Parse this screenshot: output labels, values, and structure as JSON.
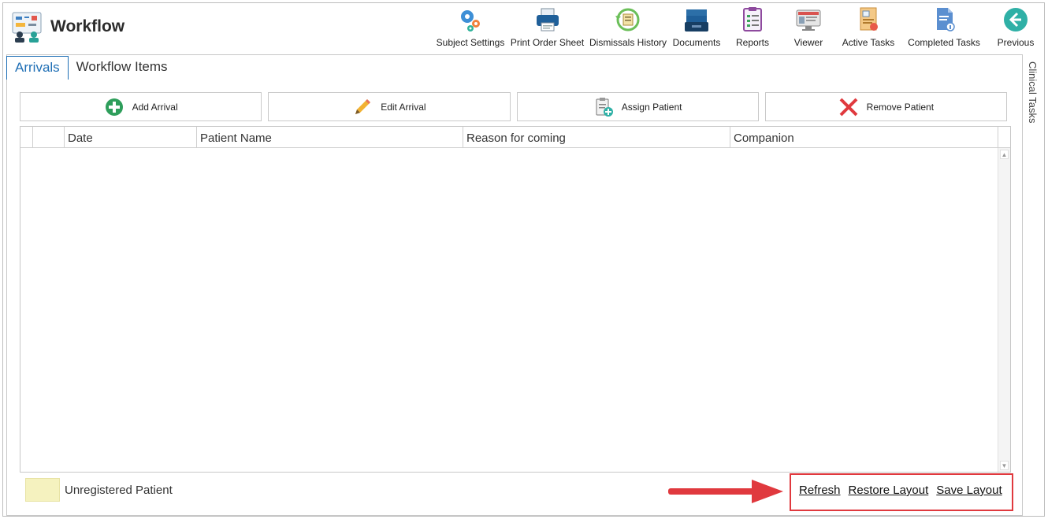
{
  "app": {
    "title": "Workflow",
    "logo_icon": "workflow-board-icon"
  },
  "toolbar": {
    "items": [
      {
        "label": "Subject Settings",
        "icon": "gears-icon"
      },
      {
        "label": "Print Order Sheet",
        "icon": "printer-icon"
      },
      {
        "label": "Dismissals History",
        "icon": "history-icon"
      },
      {
        "label": "Documents",
        "icon": "document-tray-icon"
      },
      {
        "label": "Reports",
        "icon": "report-icon"
      },
      {
        "label": "Viewer",
        "icon": "viewer-icon"
      },
      {
        "label": "Active Tasks",
        "icon": "active-tasks-icon"
      },
      {
        "label": "Completed Tasks",
        "icon": "completed-tasks-icon"
      },
      {
        "label": "Previous",
        "icon": "back-arrow-icon"
      }
    ]
  },
  "tabs": [
    {
      "label": "Arrivals",
      "active": true
    },
    {
      "label": "Workflow Items",
      "active": false
    }
  ],
  "actions": [
    {
      "label": "Add Arrival",
      "icon": "plus-circle-icon"
    },
    {
      "label": "Edit Arrival",
      "icon": "pencil-icon"
    },
    {
      "label": "Assign Patient",
      "icon": "clipboard-plus-icon"
    },
    {
      "label": "Remove Patient",
      "icon": "red-x-icon"
    }
  ],
  "grid": {
    "columns": [
      "",
      "",
      "Date",
      "Patient Name",
      "Reason for coming",
      "Companion"
    ],
    "rows": []
  },
  "legend": {
    "label": "Unregistered Patient",
    "color": "#f5f2bf"
  },
  "footer_links": [
    "Refresh",
    "Restore Layout",
    "Save Layout"
  ],
  "side_panel": {
    "label": "Clinical Tasks"
  },
  "colors": {
    "accent": "#1f6fb5",
    "highlight": "#e0393e"
  }
}
